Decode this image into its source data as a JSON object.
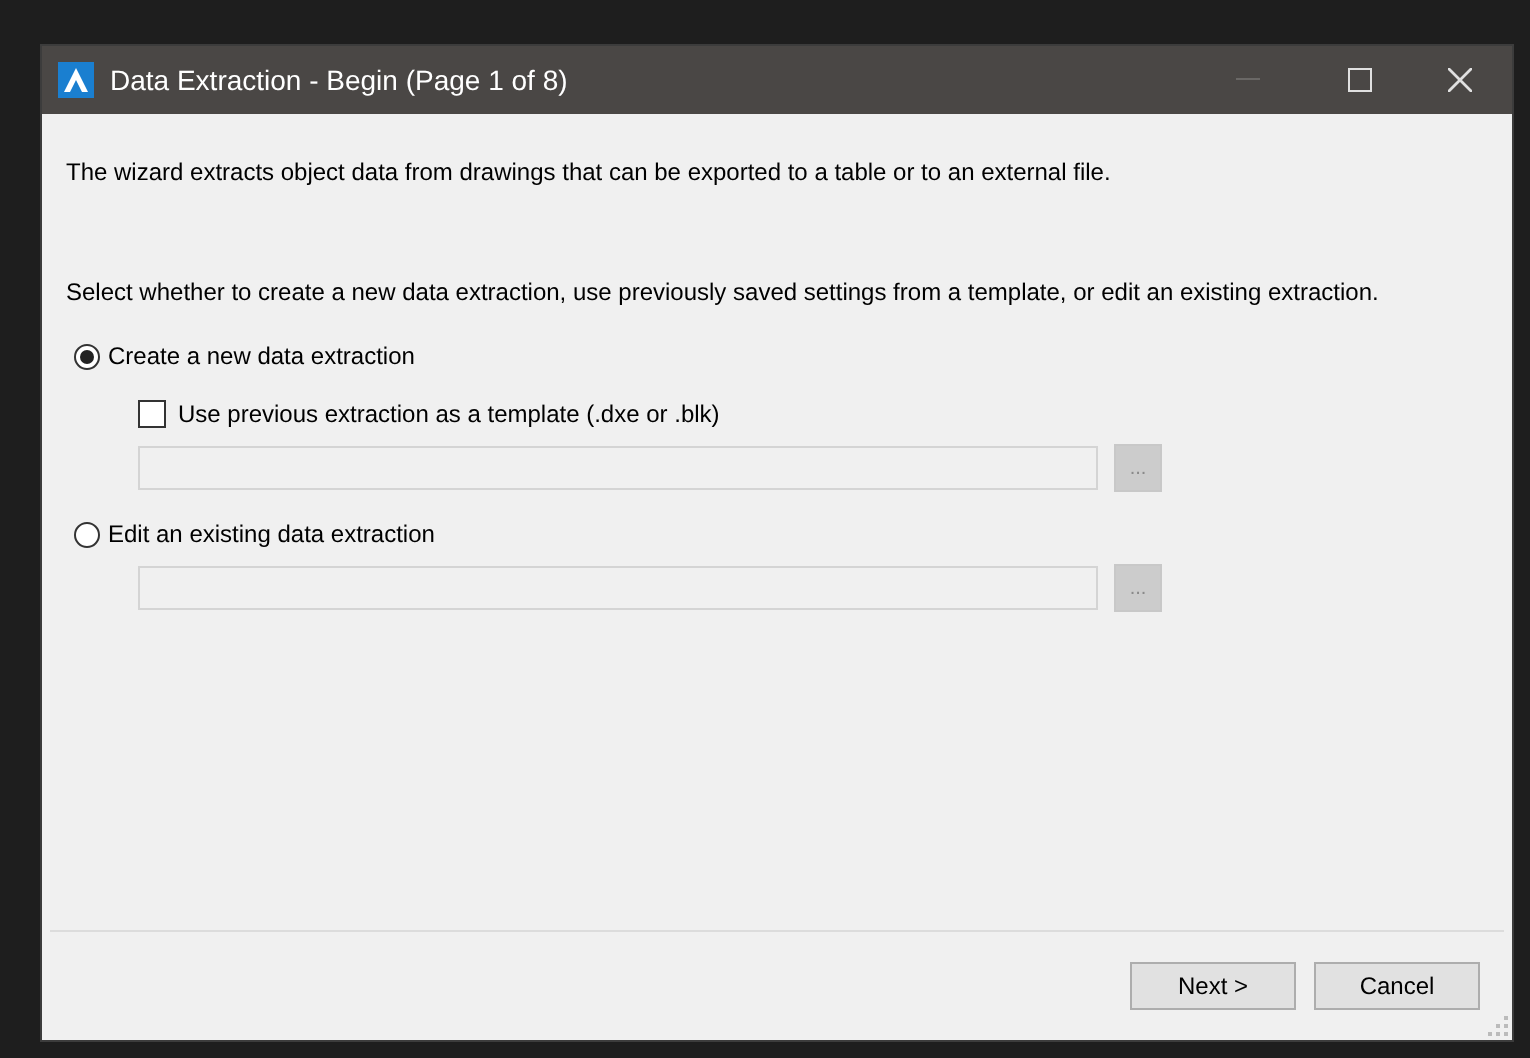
{
  "window": {
    "title": "Data Extraction - Begin (Page 1 of 8)"
  },
  "intro": "The wizard extracts object data from drawings that can be exported to a table or to an external file.",
  "instruction": "Select whether to create a new data extraction, use previously saved settings from a template, or edit an existing extraction.",
  "options": [
    {
      "label": "Create a new data extraction",
      "selected": true,
      "template_checkbox": {
        "label": "Use previous extraction as a template (.dxe or .blk)",
        "checked": false
      },
      "path_field": {
        "disabled": true
      },
      "browse_button": {
        "label": "...",
        "disabled": true
      }
    },
    {
      "label": "Edit an existing data extraction",
      "selected": false,
      "path_field": {
        "disabled": true
      },
      "browse_button": {
        "label": "...",
        "disabled": true
      }
    }
  ],
  "buttons": [
    {
      "label": "Next >"
    },
    {
      "label": "Cancel"
    }
  ]
}
